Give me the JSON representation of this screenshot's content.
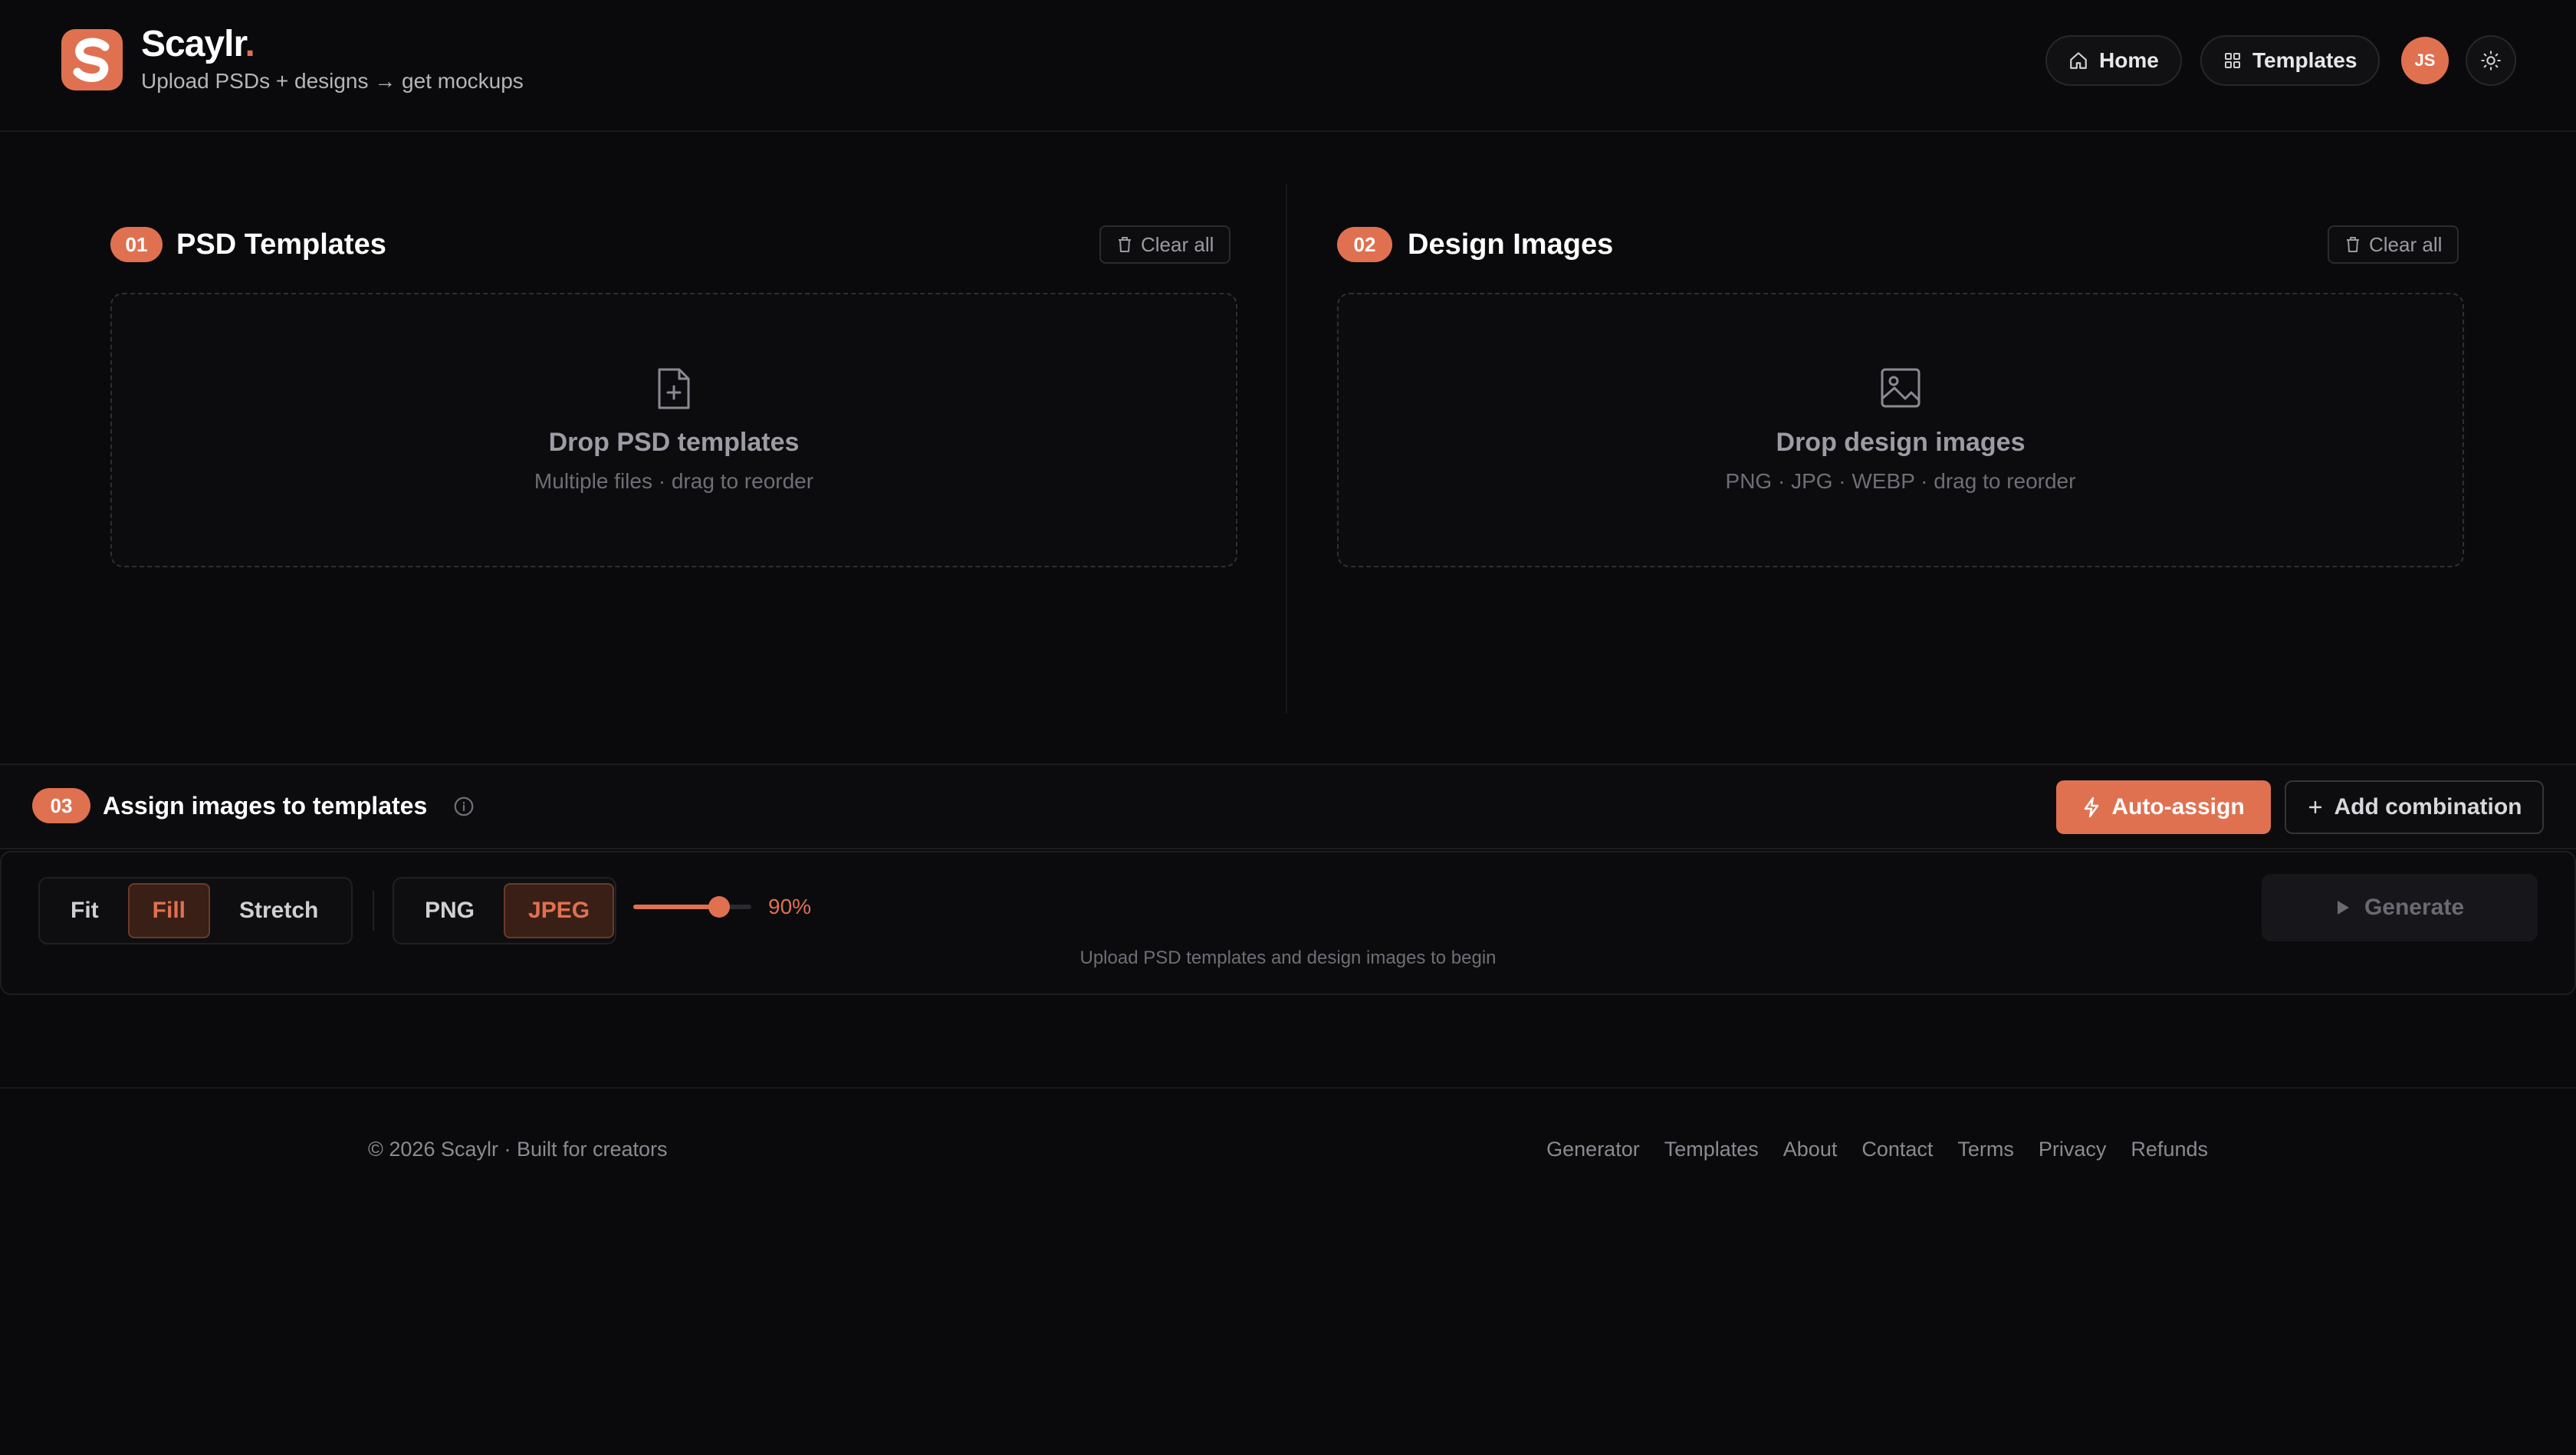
{
  "header": {
    "brand_name": "Scaylr",
    "brand_dot": ".",
    "tagline": "Upload PSDs + designs → get mockups",
    "nav": [
      {
        "label": "Home",
        "icon": "home-icon"
      },
      {
        "label": "Templates",
        "icon": "grid-icon"
      }
    ],
    "avatar_initials": "JS",
    "theme_icon": "sun-icon"
  },
  "psd_section": {
    "step": "01",
    "title": "PSD Templates",
    "clear_label": "Clear all",
    "drop_title": "Drop PSD templates",
    "drop_subtitle": "Multiple files · drag to reorder",
    "icon": "file-plus-icon"
  },
  "design_section": {
    "step": "02",
    "title": "Design Images",
    "clear_label": "Clear all",
    "drop_title": "Drop design images",
    "drop_subtitle": "PNG · JPG · WEBP · drag to reorder",
    "icon": "image-icon"
  },
  "assign": {
    "step": "03",
    "title": "Assign images to templates",
    "auto_assign_label": "Auto-assign",
    "add_combination_label": "Add combination"
  },
  "options": {
    "fit_modes": [
      {
        "label": "Fit",
        "active": false
      },
      {
        "label": "Fill",
        "active": true
      },
      {
        "label": "Stretch",
        "active": false
      }
    ],
    "formats": [
      {
        "label": "PNG",
        "active": false
      },
      {
        "label": "JPEG",
        "active": true
      }
    ],
    "quality_percent": 90,
    "quality_label": "90%",
    "generate_label": "Generate",
    "hint": "Upload PSD templates and design images to begin"
  },
  "footer": {
    "copyright": "© 2026 Scaylr · Built for creators",
    "links": [
      "Generator",
      "Templates",
      "About",
      "Contact",
      "Terms",
      "Privacy",
      "Refunds"
    ]
  },
  "colors": {
    "accent": "#e07150",
    "background": "#0a0a0c"
  }
}
